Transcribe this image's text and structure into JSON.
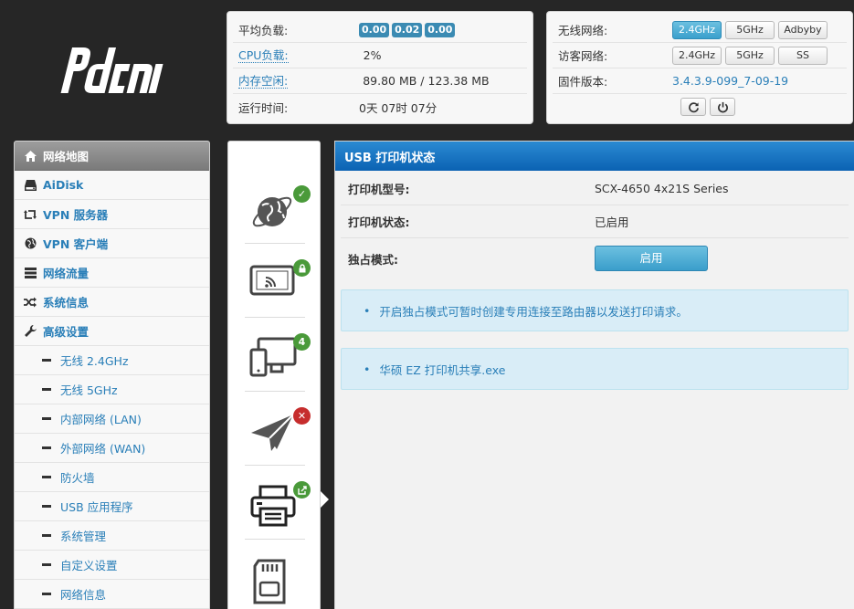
{
  "brand": {
    "logo_text": "pdcn"
  },
  "system_status": {
    "load_label": "平均负载:",
    "load_values": [
      "0.00",
      "0.02",
      "0.00"
    ],
    "cpu_label": "CPU负载:",
    "cpu_value": "2%",
    "mem_label": "内存空闲:",
    "mem_value": "89.80 MB / 123.38 MB",
    "uptime_label": "运行时间:",
    "uptime_value": "0天 07时 07分"
  },
  "network_status": {
    "wireless_label": "无线网络:",
    "wireless_buttons": [
      "2.4GHz",
      "5GHz",
      "Adbyby"
    ],
    "guest_label": "访客网络:",
    "guest_buttons": [
      "2.4GHz",
      "5GHz",
      "SS"
    ],
    "firmware_label": "固件版本:",
    "firmware_value": "3.4.3.9-099_7-09-19",
    "refresh_icon": "refresh-icon",
    "power_icon": "power-icon"
  },
  "menu": {
    "items": [
      {
        "label": "网络地图",
        "icon": "home-icon"
      },
      {
        "label": "AiDisk",
        "icon": "disk-icon"
      },
      {
        "label": "VPN 服务器",
        "icon": "retweet-icon"
      },
      {
        "label": "VPN 客户端",
        "icon": "globe-icon"
      },
      {
        "label": "网络流量",
        "icon": "list-icon"
      },
      {
        "label": "系统信息",
        "icon": "shuffle-icon"
      },
      {
        "label": "高级设置",
        "icon": "wrench-icon"
      }
    ],
    "sub_items": [
      "无线 2.4GHz",
      "无线 5GHz",
      "内部网络 (LAN)",
      "外部网络 (WAN)",
      "防火墙",
      "USB 应用程序",
      "系统管理",
      "自定义设置",
      "网络信息"
    ]
  },
  "status_tiles": {
    "client_count": "4"
  },
  "content": {
    "title": "USB 打印机状态",
    "model_label": "打印机型号:",
    "model_value": "SCX-4650 4x21S Series",
    "status_label": "打印机状态:",
    "status_value": "已启用",
    "exclusive_label": "独占模式:",
    "enable_button": "启用",
    "note1": "开启独占模式可暂时创建专用连接至路由器以发送打印请求。",
    "note2": "华硕 EZ 打印机共享.exe"
  },
  "colors": {
    "accent": "#2a7fb8",
    "header_blue": "#0b62b3",
    "active_button": "#3aa0cc",
    "ok_green": "#4a9a3a",
    "error_red": "#c62d2d"
  }
}
